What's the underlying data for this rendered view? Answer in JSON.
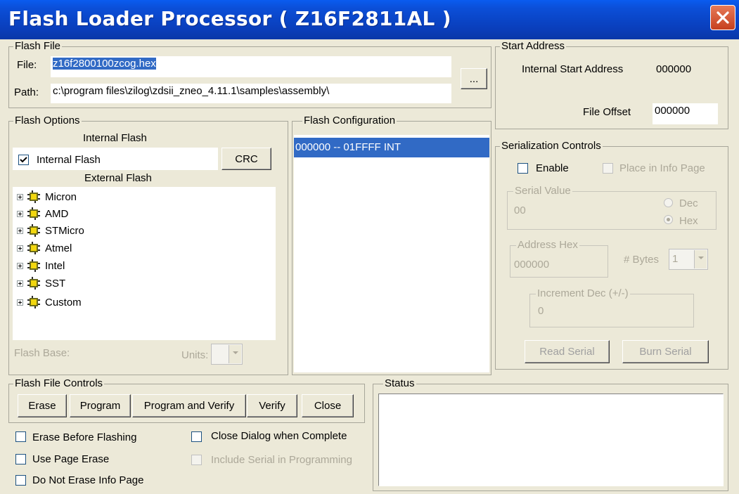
{
  "window": {
    "title": "Flash Loader Processor ( Z16F2811AL )"
  },
  "flash_file": {
    "legend": "Flash File",
    "file_label": "File:",
    "file_value": "z16f2800100zcog.hex",
    "path_label": "Path:",
    "path_value": "c:\\program files\\zilog\\zdsii_zneo_4.11.1\\samples\\assembly\\",
    "browse_label": "..."
  },
  "flash_options": {
    "legend": "Flash Options",
    "internal_header": "Internal Flash",
    "internal_checkbox_label": "Internal Flash",
    "internal_checked": true,
    "crc_label": "CRC",
    "external_header": "External Flash",
    "external_items": [
      "Micron",
      "AMD",
      "STMicro",
      "Atmel",
      "Intel",
      "SST",
      "Custom"
    ],
    "flash_base_label": "Flash Base:",
    "units_label": "Units:"
  },
  "flash_configuration": {
    "legend": "Flash Configuration",
    "items": [
      "000000 -- 01FFFF INT"
    ]
  },
  "start_address": {
    "legend": "Start Address",
    "internal_label": "Internal Start Address",
    "internal_value": "000000",
    "offset_label": "File Offset",
    "offset_value": "000000"
  },
  "serialization": {
    "legend": "Serialization Controls",
    "enable_label": "Enable",
    "place_label": "Place in Info Page",
    "serial_value_legend": "Serial Value",
    "serial_value": "00",
    "dec_label": "Dec",
    "hex_label": "Hex",
    "address_legend": "Address Hex",
    "address_value": "000000",
    "bytes_label": "# Bytes",
    "bytes_value": "1",
    "increment_legend": "Increment Dec (+/-)",
    "increment_value": "0",
    "read_label": "Read Serial",
    "burn_label": "Burn Serial"
  },
  "flash_file_controls": {
    "legend": "Flash File Controls",
    "erase_label": "Erase",
    "program_label": "Program",
    "program_verify_label": "Program and Verify",
    "verify_label": "Verify",
    "close_label": "Close"
  },
  "options": {
    "erase_before": "Erase Before Flashing",
    "use_page_erase": "Use Page Erase",
    "do_not_erase_info": "Do Not Erase Info Page",
    "close_dialog": "Close Dialog when Complete",
    "include_serial": "Include Serial in Programming"
  },
  "status": {
    "legend": "Status",
    "text": ""
  },
  "colors": {
    "title_bar": "#0a3fbd",
    "selection": "#316ac5",
    "face": "#ece9d8",
    "close_button": "#d9542f"
  },
  "icons": {
    "close": "close-icon",
    "tree_node": "chip-icon",
    "expand": "plus-expander-icon"
  }
}
